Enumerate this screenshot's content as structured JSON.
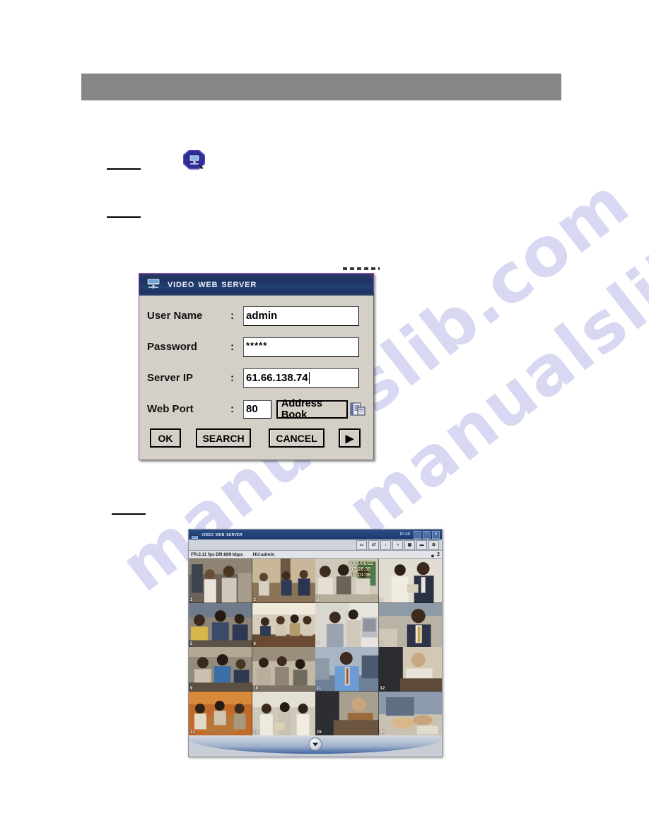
{
  "page": {
    "watermark": "manualslib.com"
  },
  "header_band": {
    "label": "section-header-band"
  },
  "app_icon": {
    "name": "video-web-server-app-icon"
  },
  "login_dialog": {
    "title": "Video Web Server",
    "title_icon": "server-monitor-icon",
    "fields": [
      {
        "label": "User Name",
        "colon": ":",
        "value": "admin",
        "name": "user-name"
      },
      {
        "label": "Password",
        "colon": ":",
        "value": "*****",
        "name": "password"
      },
      {
        "label": "Server IP",
        "colon": ":",
        "value": "61.66.138.74",
        "name": "server-ip"
      },
      {
        "label": "Web Port",
        "colon": ":",
        "value": "80",
        "name": "web-port"
      }
    ],
    "address_book": {
      "label": "Address Book",
      "icon": "address-book-icon"
    },
    "buttons": [
      {
        "label": "OK",
        "name": "ok"
      },
      {
        "label": "SEARCH",
        "name": "search"
      },
      {
        "label": "CANCEL",
        "name": "cancel"
      },
      {
        "label": "▶",
        "name": "play-advanced"
      }
    ]
  },
  "video_window": {
    "title": "Video Web Server",
    "title_icon": "server-monitor-icon",
    "ip_label": "IP:45",
    "window_buttons": [
      {
        "glyph": "–",
        "name": "minimize"
      },
      {
        "glyph": "□",
        "name": "maximize"
      },
      {
        "glyph": "✕",
        "name": "close"
      }
    ],
    "toolbar": [
      {
        "glyph": "▭",
        "name": "monitor"
      },
      {
        "glyph": "cf",
        "name": "compact-flash"
      },
      {
        "glyph": "↕",
        "name": "levels"
      },
      {
        "glyph": "◑",
        "name": "contrast"
      },
      {
        "glyph": "▣",
        "name": "record"
      },
      {
        "glyph": "▬",
        "name": "fullscreen"
      },
      {
        "glyph": "✿",
        "name": "settings"
      }
    ],
    "status": {
      "frame_rate": "FR:2.11 fps  DR:689 kbps",
      "host_user": "HU:admin",
      "user_icon": "user-icon",
      "user_count": "2"
    },
    "osd_overlay": "2005/08/22  17:28:35\n00:01:56",
    "channel_count": 16,
    "channels": [
      {
        "num": "1",
        "name": "channel-1"
      },
      {
        "num": "2",
        "name": "channel-2"
      },
      {
        "num": "3",
        "name": "channel-3"
      },
      {
        "num": "4",
        "name": "channel-4"
      },
      {
        "num": "5",
        "name": "channel-5"
      },
      {
        "num": "6",
        "name": "channel-6"
      },
      {
        "num": "7",
        "name": "channel-7"
      },
      {
        "num": "8",
        "name": "channel-8"
      },
      {
        "num": "9",
        "name": "channel-9"
      },
      {
        "num": "10",
        "name": "channel-10"
      },
      {
        "num": "11",
        "name": "channel-11"
      },
      {
        "num": "12",
        "name": "channel-12"
      },
      {
        "num": "13",
        "name": "channel-13"
      },
      {
        "num": "14",
        "name": "channel-14"
      },
      {
        "num": "15",
        "name": "channel-15"
      },
      {
        "num": "16",
        "name": "channel-16"
      }
    ],
    "expand_button": "▼"
  },
  "colors": {
    "header_band": "#878787",
    "dialog_face": "#d4d0c8",
    "dialog_title_start": "#2c3c66",
    "dialog_title_end": "#18305e",
    "dialog_accent_border": "#b44ec4",
    "watermark": "#d8d8f2"
  }
}
